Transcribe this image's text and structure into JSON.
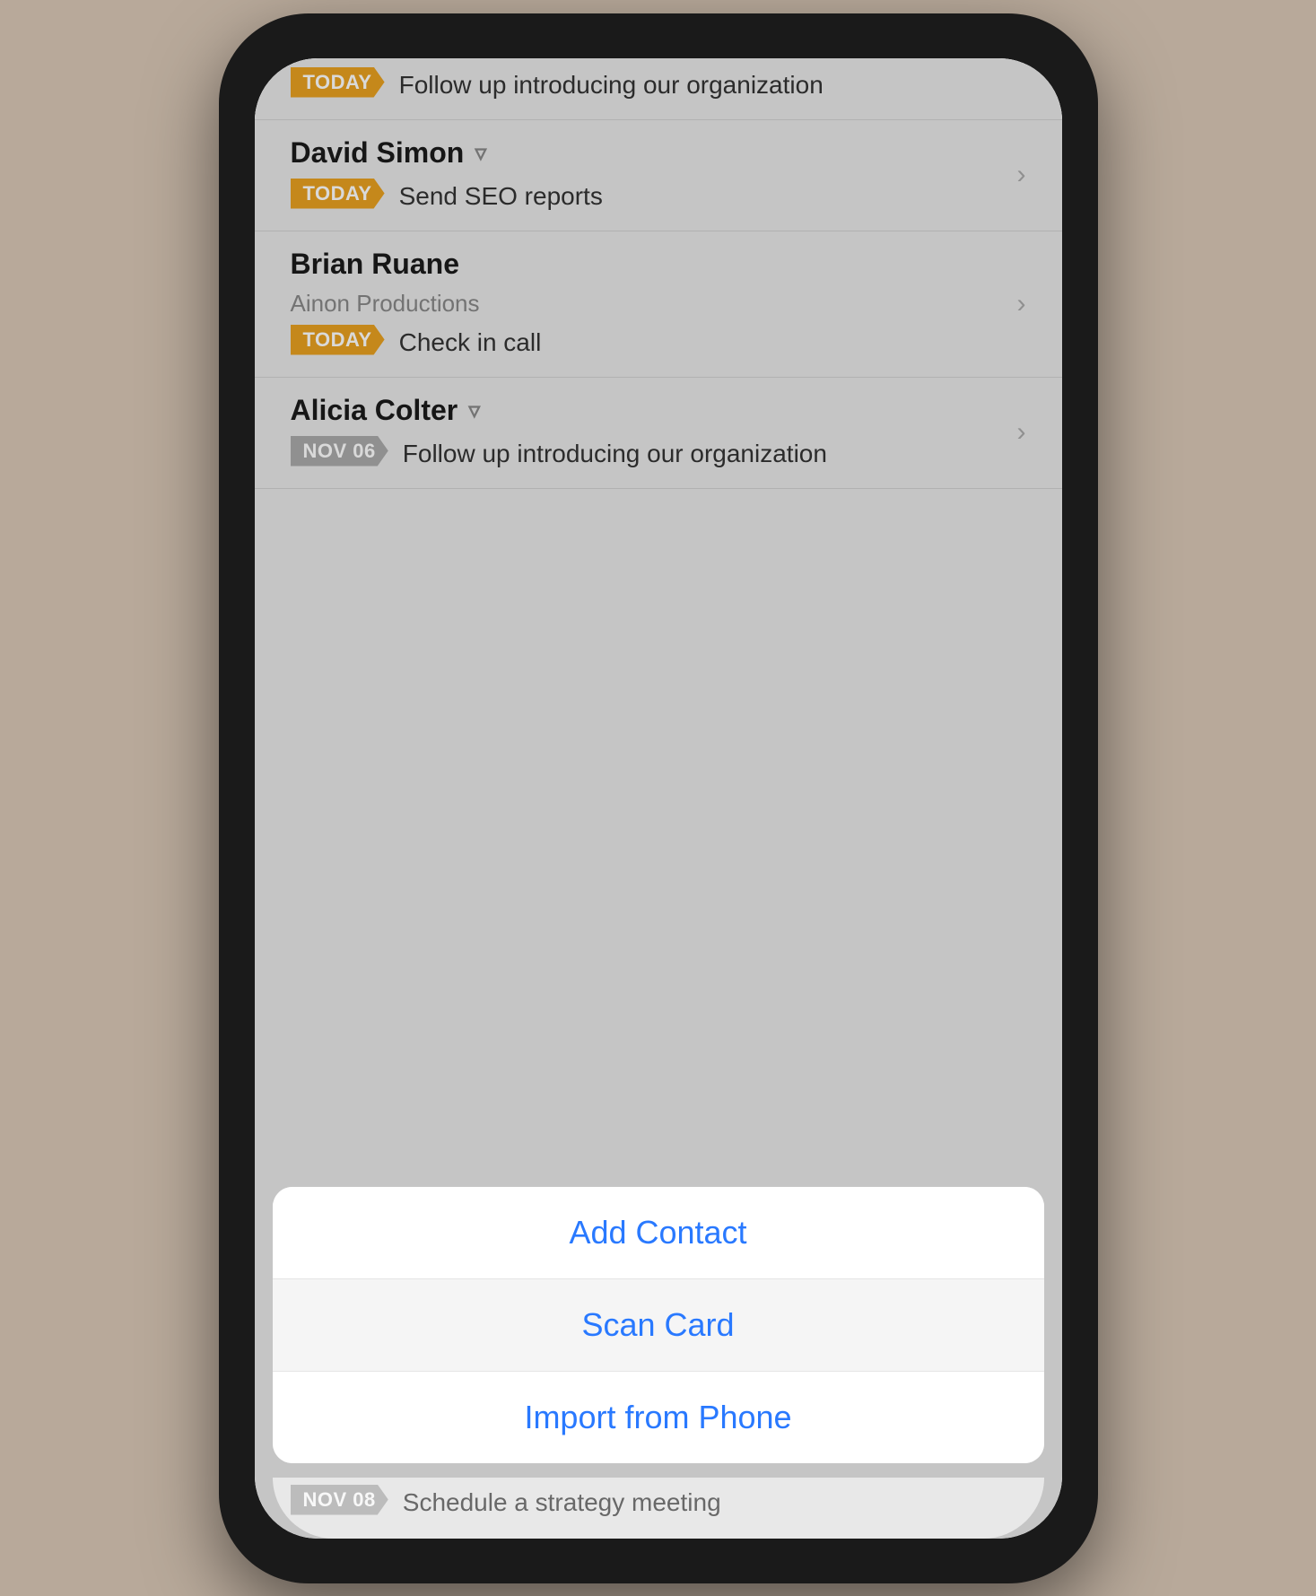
{
  "phone": {
    "background": "#b8a99a"
  },
  "contacts": [
    {
      "id": "partial-top",
      "name": null,
      "company": null,
      "tag": "TODAY",
      "tag_type": "today",
      "task": "Follow up introducing our organization",
      "partial": true
    },
    {
      "id": "david-simon",
      "name": "David Simon",
      "company": null,
      "has_filter": true,
      "tag": "TODAY",
      "tag_type": "today",
      "task": "Send SEO reports"
    },
    {
      "id": "brian-ruane",
      "name": "Brian Ruane",
      "company": "Ainon Productions",
      "has_filter": false,
      "tag": "TODAY",
      "tag_type": "today",
      "task": "Check in call"
    },
    {
      "id": "alicia-colter",
      "name": "Alicia Colter",
      "company": null,
      "has_filter": true,
      "tag": "NOV 06",
      "tag_type": "date",
      "task": "Follow up introducing our organization"
    }
  ],
  "bottom_contact": {
    "tag": "NOV 08",
    "tag_type": "date",
    "task": "Schedule a strategy meeting"
  },
  "action_sheet": {
    "items": [
      {
        "id": "add-contact",
        "label": "Add Contact"
      },
      {
        "id": "scan-card",
        "label": "Scan Card",
        "highlighted": true
      },
      {
        "id": "import-phone",
        "label": "Import from Phone"
      }
    ]
  },
  "icons": {
    "filter": "▼",
    "chevron": "›"
  }
}
